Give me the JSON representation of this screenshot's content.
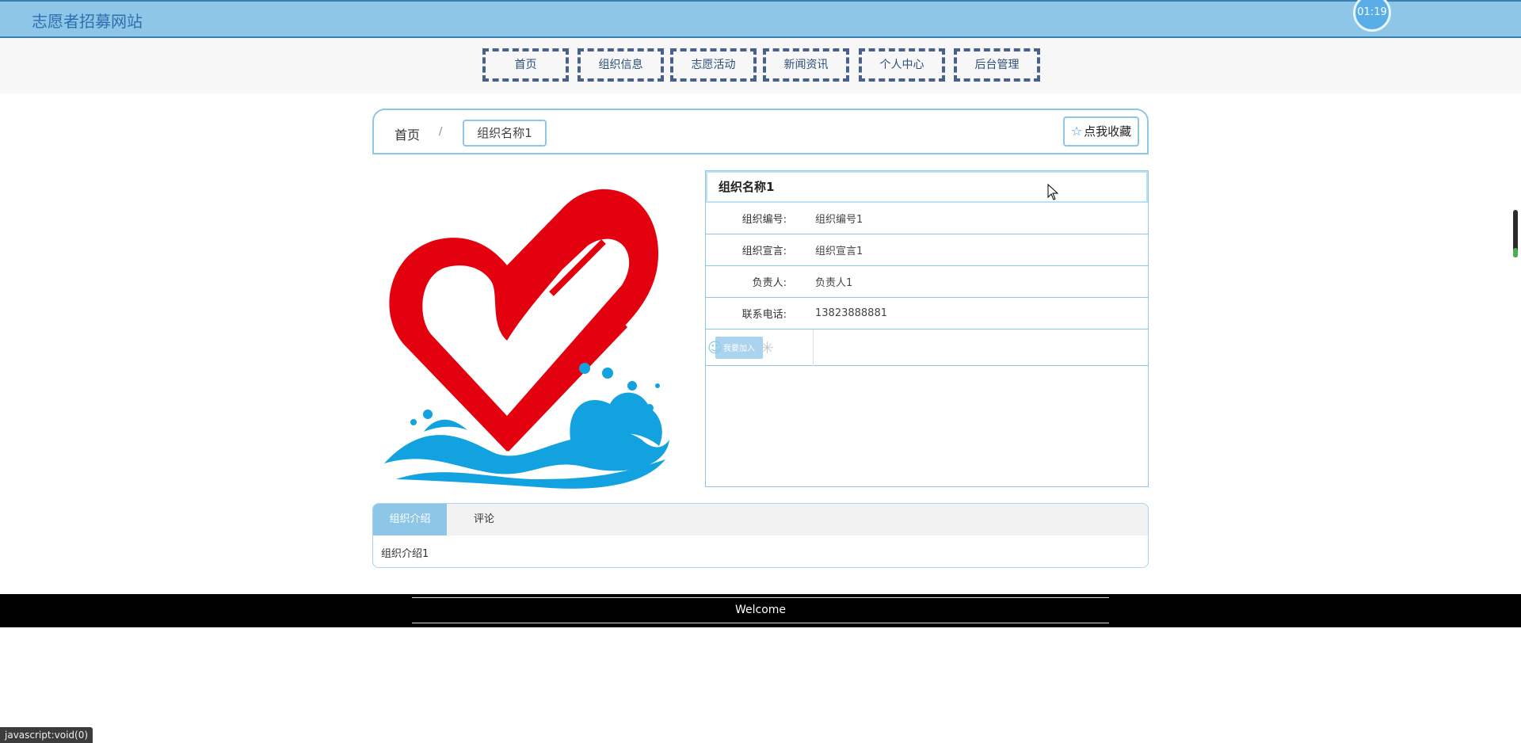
{
  "header": {
    "site_title": "志愿者招募网站",
    "timer": "01:19"
  },
  "nav": {
    "items": [
      {
        "label": "首页"
      },
      {
        "label": "组织信息"
      },
      {
        "label": "志愿活动"
      },
      {
        "label": "新闻资讯"
      },
      {
        "label": "个人中心"
      },
      {
        "label": "后台管理"
      }
    ]
  },
  "breadcrumb": {
    "home": "首页",
    "separator": "/",
    "current": "组织名称1"
  },
  "favorite_label": "点我收藏",
  "detail": {
    "title": "组织名称1",
    "rows": [
      {
        "key": "组织编号:",
        "value": "组织编号1"
      },
      {
        "key": "组织宣言:",
        "value": "组织宣言1"
      },
      {
        "key": "负责人:",
        "value": "负责人1"
      },
      {
        "key": "联系电话:",
        "value": "13823888881"
      }
    ],
    "action_label": "我要加入"
  },
  "tabs": {
    "items": [
      {
        "label": "组织介绍"
      },
      {
        "label": "评论"
      }
    ],
    "content": "组织介绍1"
  },
  "footer": {
    "text": "Welcome"
  },
  "status_bar": {
    "text": "javascript:void(0)"
  },
  "colors": {
    "header_bg": "#8dc6e6",
    "accent": "#2d6fb0",
    "heart_red": "#e3000f",
    "wave_blue": "#13a2e0"
  }
}
